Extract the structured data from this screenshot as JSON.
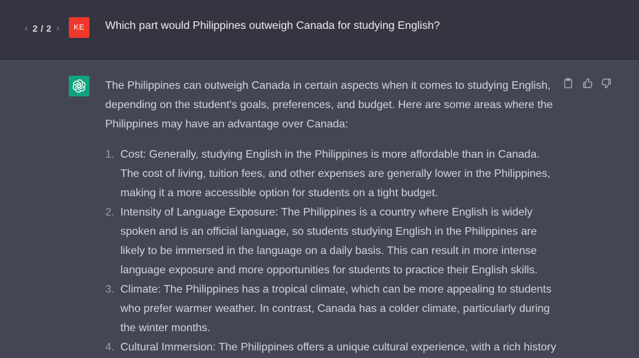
{
  "user_message": {
    "pager": {
      "prev_icon": "chevron-left-icon",
      "count": "2 / 2",
      "next_icon": "chevron-right-icon"
    },
    "avatar_initials": "KE",
    "avatar_color": "#f0372b",
    "text": "Which part would Philippines outweigh Canada for studying English?"
  },
  "assistant_message": {
    "avatar_icon": "openai-logo-icon",
    "avatar_color": "#10a37f",
    "intro": "The Philippines can outweigh Canada in certain aspects when it comes to studying English, depending on the student's goals, preferences, and budget. Here are some areas where the Philippines may have an advantage over Canada:",
    "items": [
      {
        "num": "1.",
        "text": "Cost: Generally, studying English in the Philippines is more affordable than in Canada. The cost of living, tuition fees, and other expenses are generally lower in the Philippines, making it a more accessible option for students on a tight budget."
      },
      {
        "num": "2.",
        "text": "Intensity of Language Exposure: The Philippines is a country where English is widely spoken and is an official language, so students studying English in the Philippines are likely to be immersed in the language on a daily basis. This can result in more intense language exposure and more opportunities for students to practice their English skills."
      },
      {
        "num": "3.",
        "text": "Climate: The Philippines has a tropical climate, which can be more appealing to students who prefer warmer weather. In contrast, Canada has a colder climate, particularly during the winter months."
      },
      {
        "num": "4.",
        "text": "Cultural Immersion: The Philippines offers a unique cultural experience, with a rich history"
      }
    ],
    "actions": [
      "clipboard-icon",
      "thumbs-up-icon",
      "thumbs-down-icon"
    ]
  }
}
